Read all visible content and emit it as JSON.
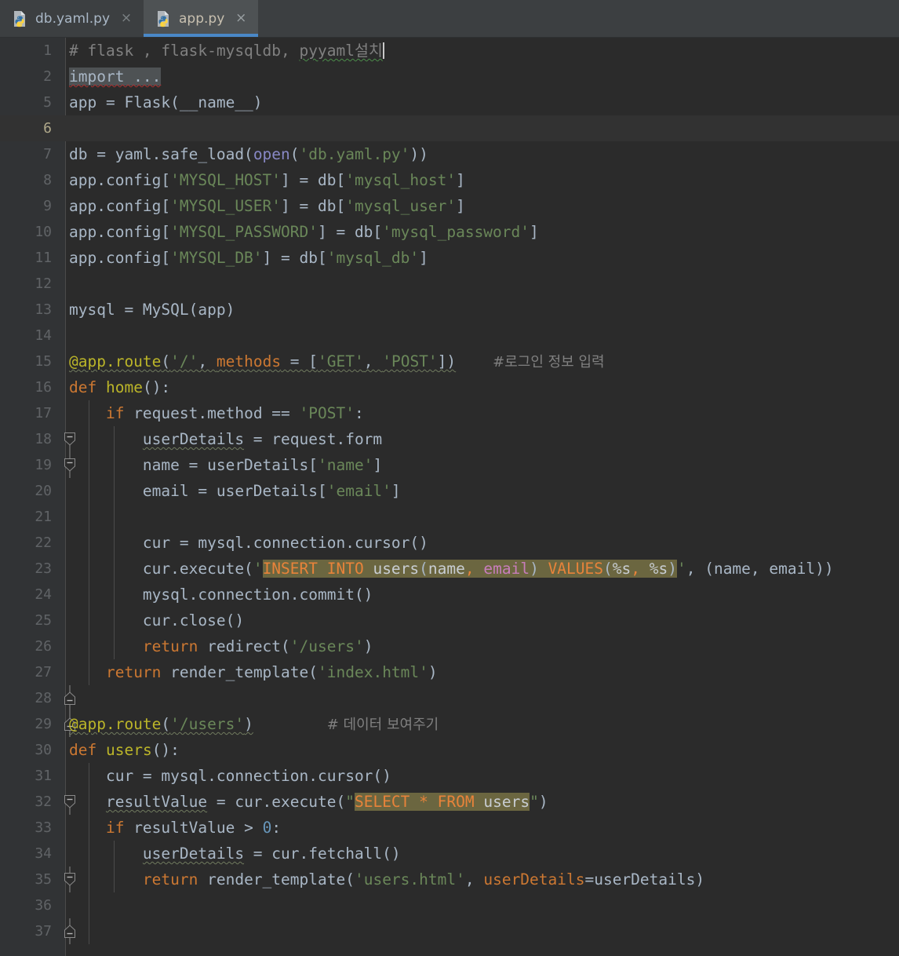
{
  "window": {
    "theme": "darcula",
    "colors": {
      "background": "#2b2b2b",
      "gutter": "#313335",
      "tabbar": "#3c3f41",
      "tab_active": "#4e5254",
      "tab_underline": "#4a88c7",
      "caret_line": "#323232",
      "string": "#6a8759",
      "keyword": "#cc7832",
      "comment": "#808080",
      "decorator": "#bbb529",
      "builtin": "#8888c6",
      "number": "#6897bb",
      "sql_fragment_bg": "#6b6640",
      "sql_keyword": "#e8833a",
      "sql_column": "#c77dbb"
    }
  },
  "tabs": [
    {
      "label": "db.yaml.py",
      "icon": "python-file-icon",
      "close": "×",
      "active": false
    },
    {
      "label": "app.py",
      "icon": "python-file-icon",
      "close": "×",
      "active": true
    }
  ],
  "editor": {
    "active_file": "app.py",
    "caret_line": 6,
    "line_numbers": [
      1,
      2,
      5,
      6,
      7,
      8,
      9,
      10,
      11,
      12,
      13,
      14,
      15,
      16,
      17,
      18,
      19,
      20,
      21,
      22,
      23,
      24,
      25,
      26,
      27,
      28,
      29,
      30,
      31,
      32,
      33,
      34,
      35,
      36,
      37
    ],
    "folded_region": {
      "line": 2,
      "placeholder": "import ...",
      "marker": "plus-fold-icon"
    },
    "lines": [
      {
        "n": 1,
        "text": "# flask , flask-mysqldb, pyyaml설치"
      },
      {
        "n": 2,
        "text": "import ..."
      },
      {
        "n": 5,
        "text": "app = Flask(__name__)"
      },
      {
        "n": 6,
        "text": ""
      },
      {
        "n": 7,
        "text": "db = yaml.safe_load(open('db.yaml.py'))"
      },
      {
        "n": 8,
        "text": "app.config['MYSQL_HOST'] = db['mysql_host']"
      },
      {
        "n": 9,
        "text": "app.config['MYSQL_USER'] = db['mysql_user']"
      },
      {
        "n": 10,
        "text": "app.config['MYSQL_PASSWORD'] = db['mysql_password']"
      },
      {
        "n": 11,
        "text": "app.config['MYSQL_DB'] = db['mysql_db']"
      },
      {
        "n": 12,
        "text": ""
      },
      {
        "n": 13,
        "text": "mysql = MySQL(app)"
      },
      {
        "n": 14,
        "text": ""
      },
      {
        "n": 15,
        "text": "@app.route('/', methods = ['GET', 'POST'])    #로그인 정보 입력"
      },
      {
        "n": 16,
        "text": "def home():"
      },
      {
        "n": 17,
        "text": "    if request.method == 'POST':"
      },
      {
        "n": 18,
        "text": "        userDetails = request.form"
      },
      {
        "n": 19,
        "text": "        name = userDetails['name']"
      },
      {
        "n": 20,
        "text": "        email = userDetails['email']"
      },
      {
        "n": 21,
        "text": ""
      },
      {
        "n": 22,
        "text": "        cur = mysql.connection.cursor()"
      },
      {
        "n": 23,
        "text": "        cur.execute('INSERT INTO users(name, email) VALUES(%s, %s)', (name, email))"
      },
      {
        "n": 24,
        "text": "        mysql.connection.commit()"
      },
      {
        "n": 25,
        "text": "        cur.close()"
      },
      {
        "n": 26,
        "text": "        return redirect('/users')"
      },
      {
        "n": 27,
        "text": "    return render_template('index.html')"
      },
      {
        "n": 28,
        "text": ""
      },
      {
        "n": 29,
        "text": "@app.route('/users')        # 데이터 보여주기"
      },
      {
        "n": 30,
        "text": "def users():"
      },
      {
        "n": 31,
        "text": "    cur = mysql.connection.cursor()"
      },
      {
        "n": 32,
        "text": "    resultValue = cur.execute(\"SELECT * FROM users\")"
      },
      {
        "n": 33,
        "text": "    if resultValue > 0:"
      },
      {
        "n": 34,
        "text": "        userDetails = cur.fetchall()"
      },
      {
        "n": 35,
        "text": "        return render_template('users.html', userDetails=userDetails)"
      },
      {
        "n": 36,
        "text": ""
      },
      {
        "n": 37,
        "text": ""
      }
    ],
    "comments": {
      "line1": "# flask , flask-mysqldb, pyyaml설치",
      "line15": "#로그인 정보 입력",
      "line29": "# 데이터 보여주기"
    },
    "sql_fragments": [
      {
        "line": 23,
        "sql": "INSERT INTO users(name, email) VALUES(%s, %s)"
      },
      {
        "line": 32,
        "sql": "SELECT * FROM users"
      }
    ],
    "fold_markers": [
      {
        "line": 2,
        "type": "expand"
      },
      {
        "line": 16,
        "type": "collapse-start"
      },
      {
        "line": 17,
        "type": "collapse-start"
      },
      {
        "line": 26,
        "type": "collapse-end"
      },
      {
        "line": 27,
        "type": "collapse-end"
      },
      {
        "line": 30,
        "type": "collapse-start"
      },
      {
        "line": 33,
        "type": "collapse-start"
      },
      {
        "line": 35,
        "type": "collapse-end"
      }
    ]
  }
}
